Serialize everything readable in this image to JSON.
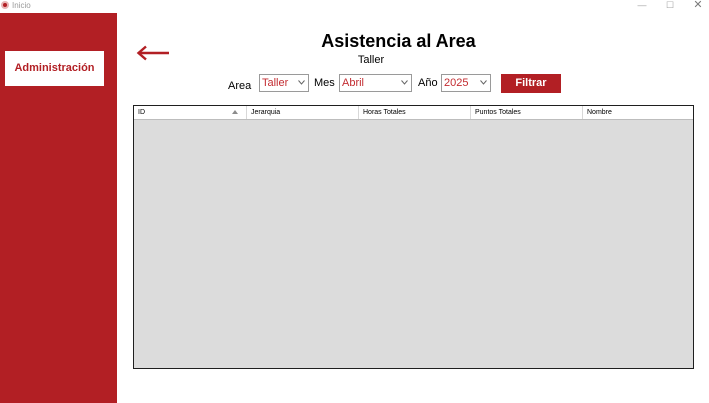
{
  "window": {
    "title": "Inicio",
    "minimize_glyph": "—",
    "maximize_glyph": "☐",
    "close_glyph": "✕"
  },
  "sidebar": {
    "items": [
      {
        "label": "Administración"
      }
    ]
  },
  "header": {
    "title": "Asistencia al Area",
    "subtitle": "Taller"
  },
  "filters": {
    "area_label": "Area",
    "area_value": "Taller",
    "mes_label": "Mes",
    "mes_value": "Abril",
    "anio_label": "Año",
    "anio_value": "2025",
    "filter_button": "Filtrar"
  },
  "table": {
    "columns": [
      "ID",
      "Jerarquia",
      "Horas Totales",
      "Puntos Totales",
      "Nombre"
    ],
    "sorted_column": "ID",
    "sort_direction": "ascending",
    "rows": []
  },
  "colors": {
    "brand_red": "#b21f24",
    "combo_text": "#c32c31",
    "grid_background": "#dcdcdc"
  },
  "icons": {
    "app": "app-logo-icon",
    "back": "arrow-left-icon",
    "dropdown": "chevron-down-icon",
    "sort": "sort-ascending-icon"
  }
}
